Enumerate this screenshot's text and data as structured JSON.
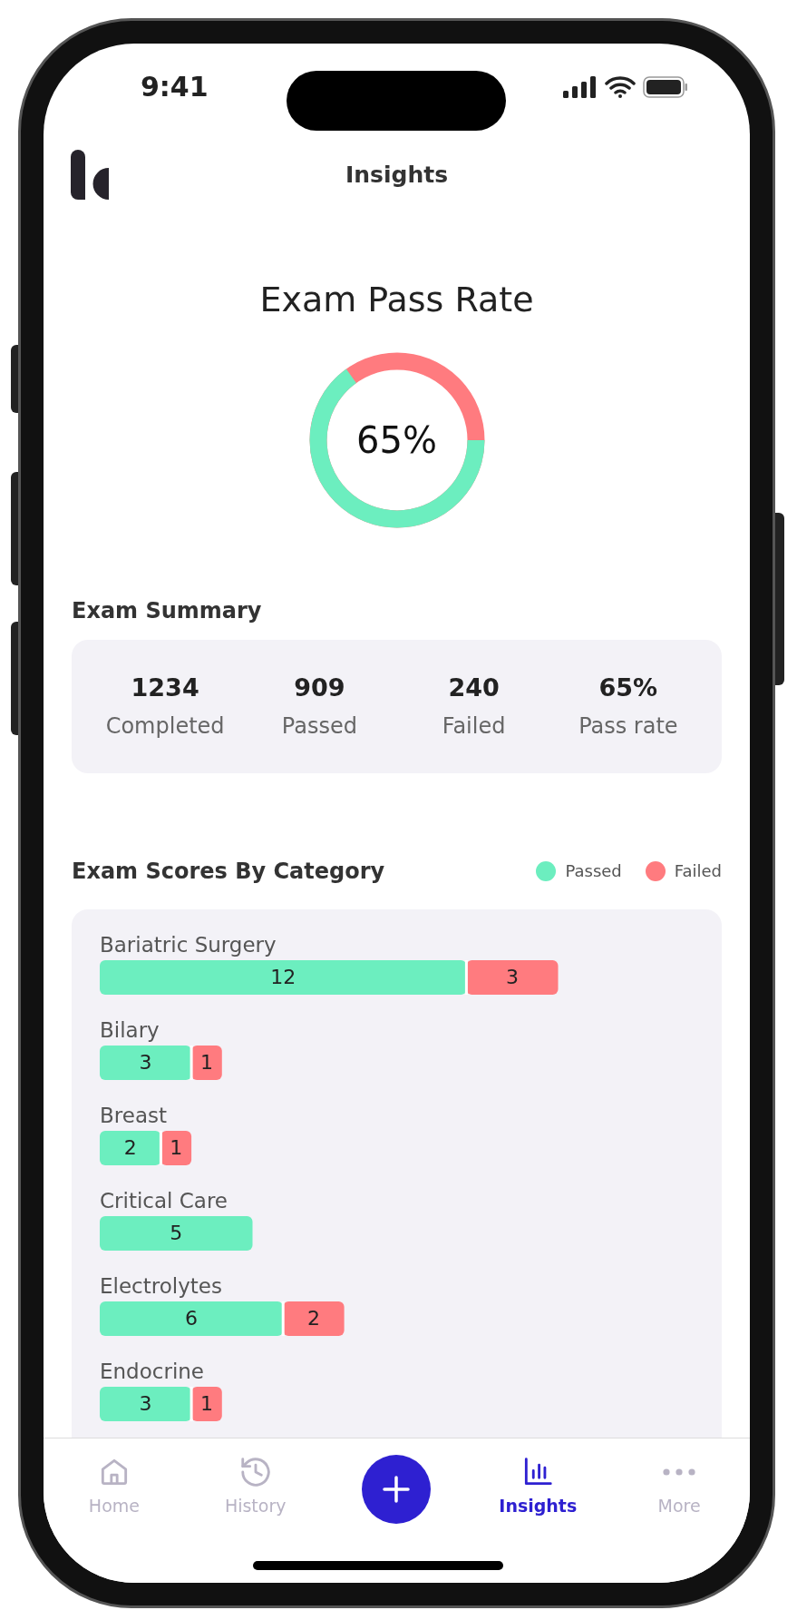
{
  "status_bar": {
    "time": "9:41"
  },
  "header": {
    "title": "Insights"
  },
  "pass_rate": {
    "title": "Exam Pass Rate",
    "level": 0.65,
    "value": "65%"
  },
  "summary": {
    "title": "Exam Summary",
    "stats": [
      {
        "value": "1234",
        "label": "Completed"
      },
      {
        "value": "909",
        "label": "Passed"
      },
      {
        "value": "240",
        "label": "Failed"
      },
      {
        "value": "65%",
        "label": "Pass rate"
      }
    ]
  },
  "scores": {
    "title": "Exam Scores By Category",
    "chart_data": {
      "type": "bar",
      "orientation": "horizontal",
      "stacked": true,
      "data_labels": true,
      "categories": [
        "Bariatric Surgery",
        "Bilary",
        "Breast",
        "Critical Care",
        "Electrolytes",
        "Endocrine"
      ],
      "series": [
        {
          "name": "Passed",
          "color": "#6ceebf",
          "values": [
            12,
            3,
            2,
            5,
            6,
            3
          ]
        },
        {
          "name": "Failed",
          "color": "#ff7b7f",
          "values": [
            3,
            1,
            1,
            null,
            2,
            1
          ]
        }
      ]
    }
  },
  "tab_bar": [
    {
      "kind": "tab",
      "label": "Home",
      "selected": false
    },
    {
      "kind": "tab",
      "label": "History",
      "selected": false
    },
    {
      "kind": "fab"
    },
    {
      "kind": "tab",
      "label": "Insights",
      "selected": true
    },
    {
      "kind": "tab",
      "label": "More",
      "selected": false
    }
  ]
}
